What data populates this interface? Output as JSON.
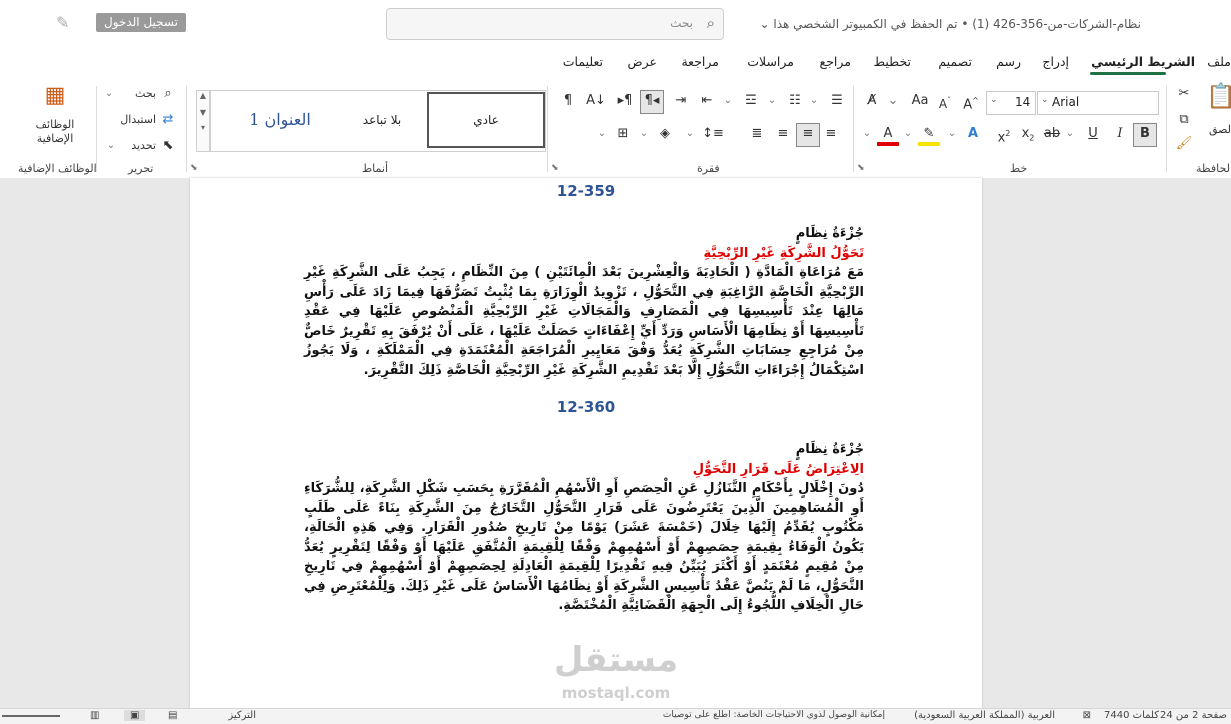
{
  "titlebar": {
    "title": "نظام-الشركات-من-356-426 (1) • تم الحفظ في الكمبيوتر الشخصي هذا ⌄",
    "search_placeholder": "بحث",
    "login_label": "تسجيل الدخول"
  },
  "tabs": [
    {
      "label": "ملف",
      "active": false
    },
    {
      "label": "الشريط الرئيسي",
      "active": true
    },
    {
      "label": "إدراج",
      "active": false
    },
    {
      "label": "رسم",
      "active": false
    },
    {
      "label": "تصميم",
      "active": false
    },
    {
      "label": "تخطيط",
      "active": false
    },
    {
      "label": "مراجع",
      "active": false
    },
    {
      "label": "مراسلات",
      "active": false
    },
    {
      "label": "مراجعة",
      "active": false
    },
    {
      "label": "عرض",
      "active": false
    },
    {
      "label": "تعليمات",
      "active": false
    }
  ],
  "ribbon": {
    "groups": {
      "clipboard": "الحافظة",
      "font": "خط",
      "paragraph": "فقرة",
      "styles": "أنماط",
      "editing": "تحرير",
      "addins": "الوظائف الإضافية"
    },
    "paste_label": "لصق",
    "font_name": "Arial",
    "font_size": "14",
    "styles": {
      "normal": "عادي",
      "no_spacing": "بلا تباعد",
      "heading1": "العنوان 1"
    },
    "editing": {
      "find": "بحث",
      "replace": "استبدال",
      "select": "تحديد"
    },
    "addins_button": "الوظائف الإضافية"
  },
  "document": {
    "articles": [
      {
        "number": "12-359",
        "part": "جُزْءَةُ نِظَامٍ",
        "heading": "تَحَوُّلُ الشَّرِكَةِ غَيْرِ الرِّبْحِيَّةِ",
        "body": "مَعَ مُرَاعَاةِ الْمَادَّةِ ( الْحَادِيَةَ وَالْعِشْرِينَ بَعْدَ الْمِائَتَيْنِ ) مِنَ النِّظَامِ ، يَجِبُ عَلَى الشَّرِكَةِ غَيْرِ الرِّبْحِيَّةِ الْخَاصَّةِ الرَّاغِبَةِ فِي التَّحَوُّلِ ، تَزْوِيدُ الْوِزَارَةِ بِمَا يُثْبِتُ تَصَرُّفَهَا فِيمَا زَادَ عَلَى رَأْسِ مَالِهَا عِنْدَ تَأْسِيسِهَا فِي الْمَصَارِفِ وَالْمَجَالَاتِ غَيْرِ الرِّبْحِيَّةِ الْمَنْصُوصِ عَلَيْهَا فِي عَقْدِ تَأْسِيسِهَا أَوْ نِظَامِهَا الْأَسَاسِ وَرَدِّ أَيِّ إِعْفَاءَاتٍ حَصَلَتْ عَلَيْهَا ، عَلَى أَنْ يُرْفَقَ بِهِ تَقْرِيرٌ خَاصٌّ مِنْ مُرَاجِعِ حِسَابَاتِ الشَّرِكَةِ يُعَدُّ وَفْقَ مَعَايِيرِ الْمُرَاجَعَةِ الْمُعْتَمَدَةِ فِي الْمَمْلَكَةِ ، وَلَا يَجُوزُ اسْتِكْمَالُ إِجْرَاءَاتِ التَّحَوُّلِ إِلَّا بَعْدَ تَقْدِيمِ الشَّرِكَةِ غَيْرِ الرِّبْحِيَّةِ الْخَاصَّةِ ذَلِكَ التَّقْرِيرَ."
      },
      {
        "number": "12-360",
        "part": "جُزْءَةُ نِظَامٍ",
        "heading": "الِاعْتِرَاضُ عَلَى قَرَارِ التَّحَوُّلِ",
        "body": "دُونَ إِخْلَالٍ بِأَحْكَامِ التَّنَازُلِ عَنِ الْحِصَصِ أَوِ الْأَسْهُمِ الْمُقَرَّرَةِ بِحَسَبِ شَكْلِ الشَّرِكَةِ، لِلشُّرَكَاءِ أَوِ الْمُسَاهِمِينَ الَّذِينَ يَعْتَرِضُونَ عَلَى قَرَارِ التَّحَوُّلِ التَّخَارُجُ مِنَ الشَّرِكَةِ بِنَاءً عَلَى طَلَبٍ مَكْتُوبٍ يُقَدِّمُ إِلَيْهَا خِلَالَ (خَمْسَةَ عَشَرَ) يَوْمًا مِنْ تَارِيخِ صُدُورِ الْقَرَارِ. وَفِي هَذِهِ الْحَالَةِ، يَكُونُ الْوَفَاءُ بِقِيمَةِ حِصَصِهِمْ أَوْ أَسْهُمِهِمْ وَفْقًا لِلْقِيمَةِ الْمُتَّفَقِ عَلَيْهَا أَوْ وَفْقًا لِتَقْرِيرٍ يُعَدُّ مِنْ مُقِيمٍ مُعْتَمَدٍ أَوْ أَكْثَرَ يُبَيِّنُ فِيهِ تَقْدِيرًا لِلْقِيمَةِ الْعَادِلَةِ لِحِصَصِهِمْ أَوْ أَسْهُمِهِمْ فِي تَارِيخِ التَّحَوُّلِ، مَا لَمْ يَنُصَّ عَقْدُ تَأْسِيسِ الشَّرِكَةِ أَوْ نِظَامُهَا الْأَسَاسُ عَلَى غَيْرِ ذَلِكَ. وَلِلْمُعْتَرِضِ فِي حَالِ الْخِلَافِ اللُّجُوءُ إِلَى الْجِهَةِ الْقَضَائِيَّةِ الْمُخْتَصَّةِ."
      }
    ],
    "watermark": "مستقل",
    "watermark_sub": "mostaql.com"
  },
  "statusbar": {
    "page": "صفحة 2 من 24",
    "words": "7440 كلمات",
    "language": "العربية (المملكة العربية السعودية)",
    "accessibility": "إمكانية الوصول لذوي الاحتياجات الخاصة: اطلع على توصيات",
    "focus": "التركيز"
  },
  "colors": {
    "accent": "#1e7145",
    "heading_red": "#e00000",
    "number_blue": "#2f5496"
  }
}
